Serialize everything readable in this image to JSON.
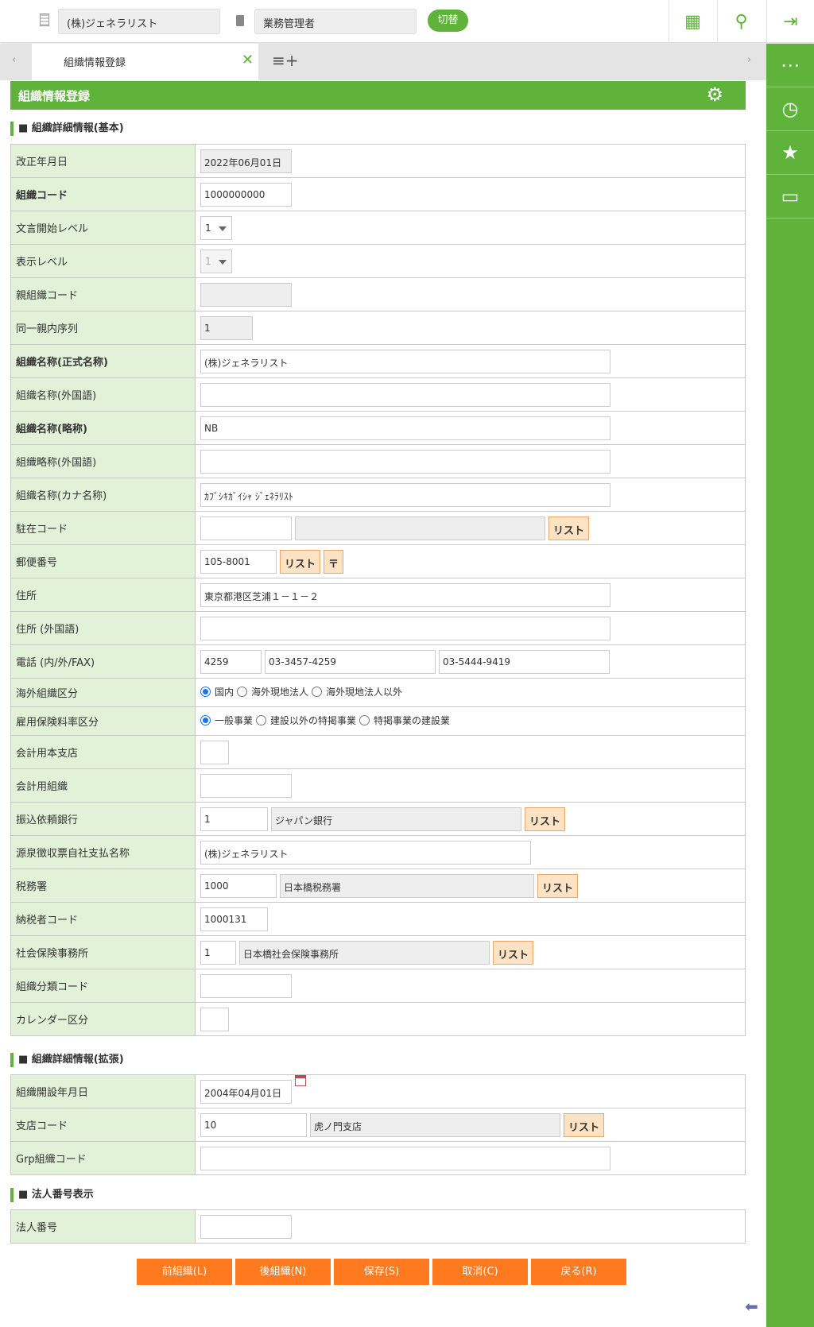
{
  "header": {
    "company": "(株)ジェネラリスト",
    "role": "業務管理者",
    "switch_label": "切替"
  },
  "tabs": {
    "active": "組織情報登録"
  },
  "page_title": "組織情報登録",
  "sections": [
    {
      "title": "■ 組織詳細情報(基本)",
      "rows": [
        {
          "label": "改正年月日",
          "bold": false,
          "values": [
            "2022年06月01日"
          ]
        },
        {
          "label": "組織コード",
          "bold": true,
          "values": [
            "1000000000"
          ]
        },
        {
          "label": "文言開始レベル",
          "bold": false,
          "values": [
            "1"
          ]
        },
        {
          "label": "表示レベル",
          "bold": false,
          "values": [
            "1"
          ]
        },
        {
          "label": "親組織コード",
          "bold": false,
          "values": [
            ""
          ]
        },
        {
          "label": "同一親内序列",
          "bold": false,
          "values": [
            "1"
          ]
        },
        {
          "label": "組織名称(正式名称)",
          "bold": true,
          "values": [
            "(株)ジェネラリスト"
          ]
        },
        {
          "label": "組織名称(外国語)",
          "bold": false,
          "values": [
            ""
          ]
        },
        {
          "label": "組織名称(略称)",
          "bold": true,
          "values": [
            "NB"
          ]
        },
        {
          "label": "組織略称(外国語)",
          "bold": false,
          "values": [
            ""
          ]
        },
        {
          "label": "組織名称(カナ名称)",
          "bold": false,
          "values": [
            "ｶﾌﾞｼｷｶﾞｲｼｬ ｼﾞｪﾈﾗﾘｽﾄ"
          ]
        },
        {
          "label": "駐在コード",
          "bold": false,
          "values": [
            "",
            ""
          ],
          "button": "リスト"
        },
        {
          "label": "郵便番号",
          "bold": false,
          "values": [
            "105-8001"
          ],
          "button": "リスト",
          "button2": "〒"
        },
        {
          "label": "住所",
          "bold": false,
          "values": [
            "東京都港区芝浦１－１－２"
          ]
        },
        {
          "label": "住所 (外国語)",
          "bold": false,
          "values": [
            ""
          ]
        },
        {
          "label": "電話 (内/外/FAX)",
          "bold": false,
          "values": [
            "4259",
            "03-3457-4259",
            "03-5444-9419"
          ]
        },
        {
          "label": "海外組織区分",
          "bold": false,
          "radios": [
            "国内",
            "海外現地法人",
            "海外現地法人以外"
          ],
          "selected": 0
        },
        {
          "label": "雇用保険料率区分",
          "bold": false,
          "radios": [
            "一般事業",
            "建設以外の特掲事業",
            "特掲事業の建設業"
          ],
          "selected": 0
        },
        {
          "label": "会計用本支店",
          "bold": false,
          "values": [
            ""
          ]
        },
        {
          "label": "会計用組織",
          "bold": false,
          "values": [
            ""
          ]
        },
        {
          "label": "振込依頼銀行",
          "bold": false,
          "values": [
            "1",
            "ジャパン銀行"
          ],
          "button": "リスト"
        },
        {
          "label": "源泉徴収票自社支払名称",
          "bold": false,
          "values": [
            "(株)ジェネラリスト"
          ]
        },
        {
          "label": "税務署",
          "bold": false,
          "values": [
            "1000",
            "日本橋税務署"
          ],
          "button": "リスト"
        },
        {
          "label": "納税者コード",
          "bold": false,
          "values": [
            "1000131"
          ]
        },
        {
          "label": "社会保険事務所",
          "bold": false,
          "values": [
            "1",
            "日本橋社会保険事務所"
          ],
          "button": "リスト"
        },
        {
          "label": "組織分類コード",
          "bold": false,
          "values": [
            ""
          ]
        },
        {
          "label": "カレンダー区分",
          "bold": false,
          "values": [
            ""
          ]
        }
      ]
    },
    {
      "title": "■ 組織詳細情報(拡張)",
      "rows": [
        {
          "label": "組織開設年月日",
          "bold": false,
          "values": [
            "2004年04月01日"
          ],
          "calendar": true
        },
        {
          "label": "支店コード",
          "bold": false,
          "values": [
            "10",
            "虎ノ門支店"
          ],
          "button": "リスト"
        },
        {
          "label": "Grp組織コード",
          "bold": false,
          "values": [
            ""
          ]
        }
      ]
    },
    {
      "title": "■ 法人番号表示",
      "rows": [
        {
          "label": "法人番号",
          "bold": false,
          "values": [
            ""
          ]
        }
      ]
    }
  ],
  "buttons": [
    "前組織(L)",
    "後組織(N)",
    "保存(S)",
    "取消(C)",
    "戻る(R)"
  ]
}
